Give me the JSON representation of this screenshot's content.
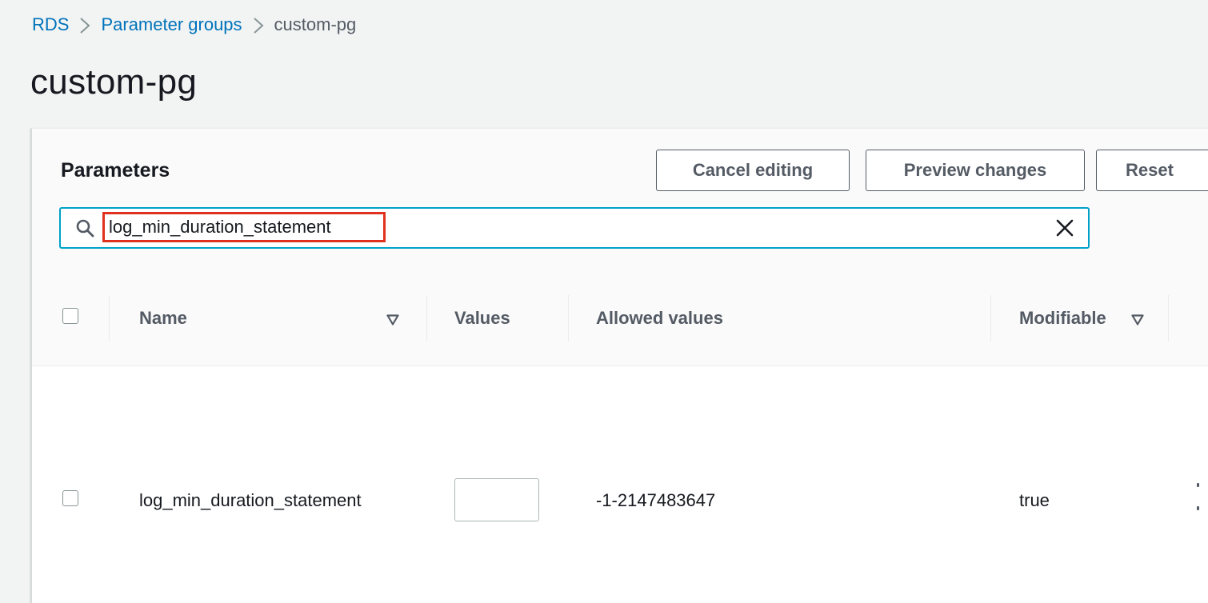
{
  "breadcrumb": {
    "items": [
      {
        "label": "RDS"
      },
      {
        "label": "Parameter groups"
      },
      {
        "label": "custom-pg"
      }
    ]
  },
  "page": {
    "title": "custom-pg"
  },
  "panel": {
    "title": "Parameters",
    "buttons": {
      "cancel": "Cancel editing",
      "preview": "Preview changes",
      "reset": "Reset"
    },
    "search": {
      "value": "log_min_duration_statement",
      "icon": "search-icon",
      "clear_icon": "close-icon"
    }
  },
  "table": {
    "columns": [
      {
        "label": "Name",
        "sortable": true
      },
      {
        "label": "Values",
        "sortable": false
      },
      {
        "label": "Allowed values",
        "sortable": false
      },
      {
        "label": "Modifiable",
        "sortable": true
      }
    ],
    "rows": [
      {
        "name": "log_min_duration_statement",
        "value": "",
        "allowed_values": "-1-2147483647",
        "modifiable": "true"
      }
    ]
  },
  "colors": {
    "link": "#0073bb",
    "focus": "#00a1c9",
    "highlight": "#e0301e",
    "background": "#f2f3f3"
  }
}
